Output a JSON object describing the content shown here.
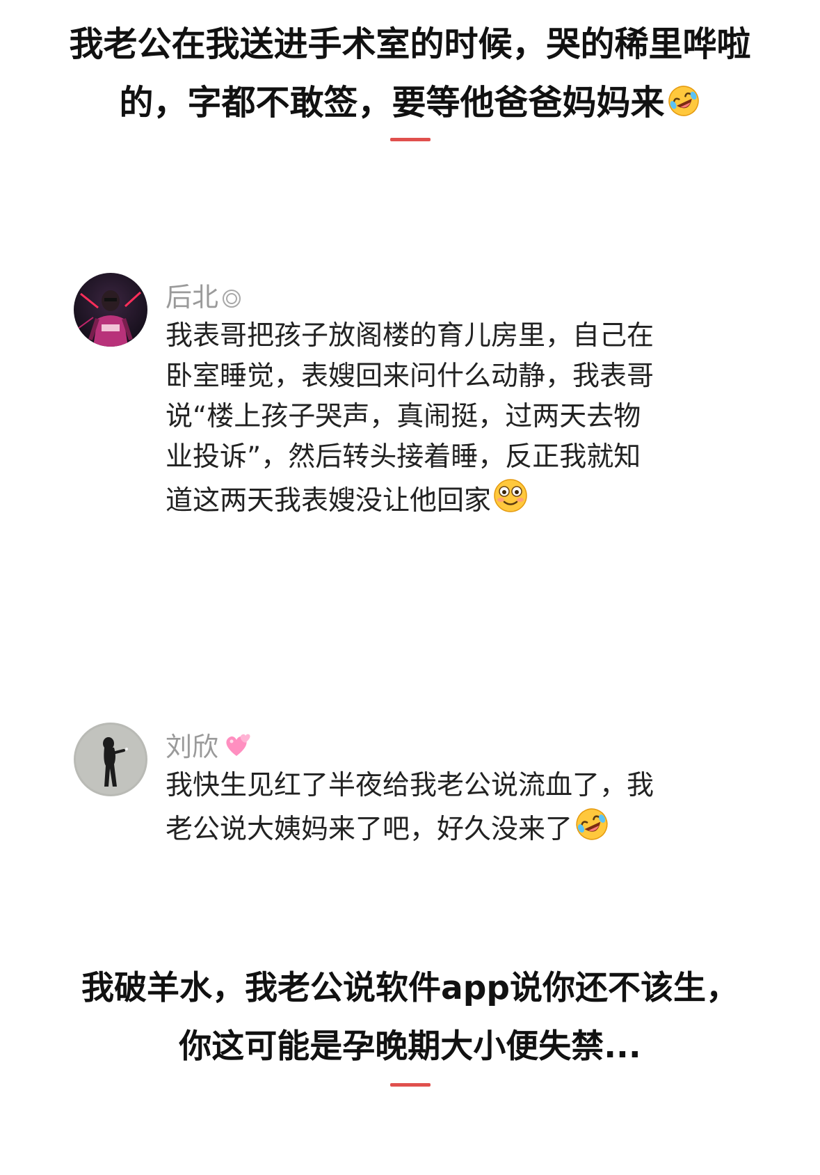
{
  "post": {
    "heading_top_lines": [
      "我老公在我送进手术室的时候，哭的稀里哗啦",
      "的，字都不敢签，要等他爸爸妈妈来"
    ],
    "heading_top_emoji": "rofl-emoji",
    "heading_bottom_lines": [
      "我破羊水，我老公说软件app说你还不该生，",
      "你这可能是孕晚期大小便失禁..."
    ]
  },
  "comments": [
    {
      "username": "后北",
      "badge": "circle-badge-icon",
      "avatar": "avatar-person-red-neon",
      "text_lines": [
        "我表哥把孩子放阁楼的育儿房里，自己在",
        "卧室睡觉，表嫂回来问什么动静，我表哥",
        "说“楼上孩子哭声，真闹挺，过两天去物",
        "业投诉”，然后转头接着睡，反正我就知",
        "道这两天我表嫂没让他回家"
      ],
      "emoji": "flushed-smile-emoji"
    },
    {
      "username": "刘欣",
      "badge": "pink-hearts-icon",
      "avatar": "avatar-silhouette-grey",
      "text_lines": [
        "我快生见红了半夜给我老公说流血了，我",
        "老公说大姨妈来了吧，好久没来了"
      ],
      "emoji": "rofl-emoji"
    }
  ],
  "colors": {
    "divider": "#e0504d",
    "username": "#9a9a9a",
    "text": "#222222"
  }
}
